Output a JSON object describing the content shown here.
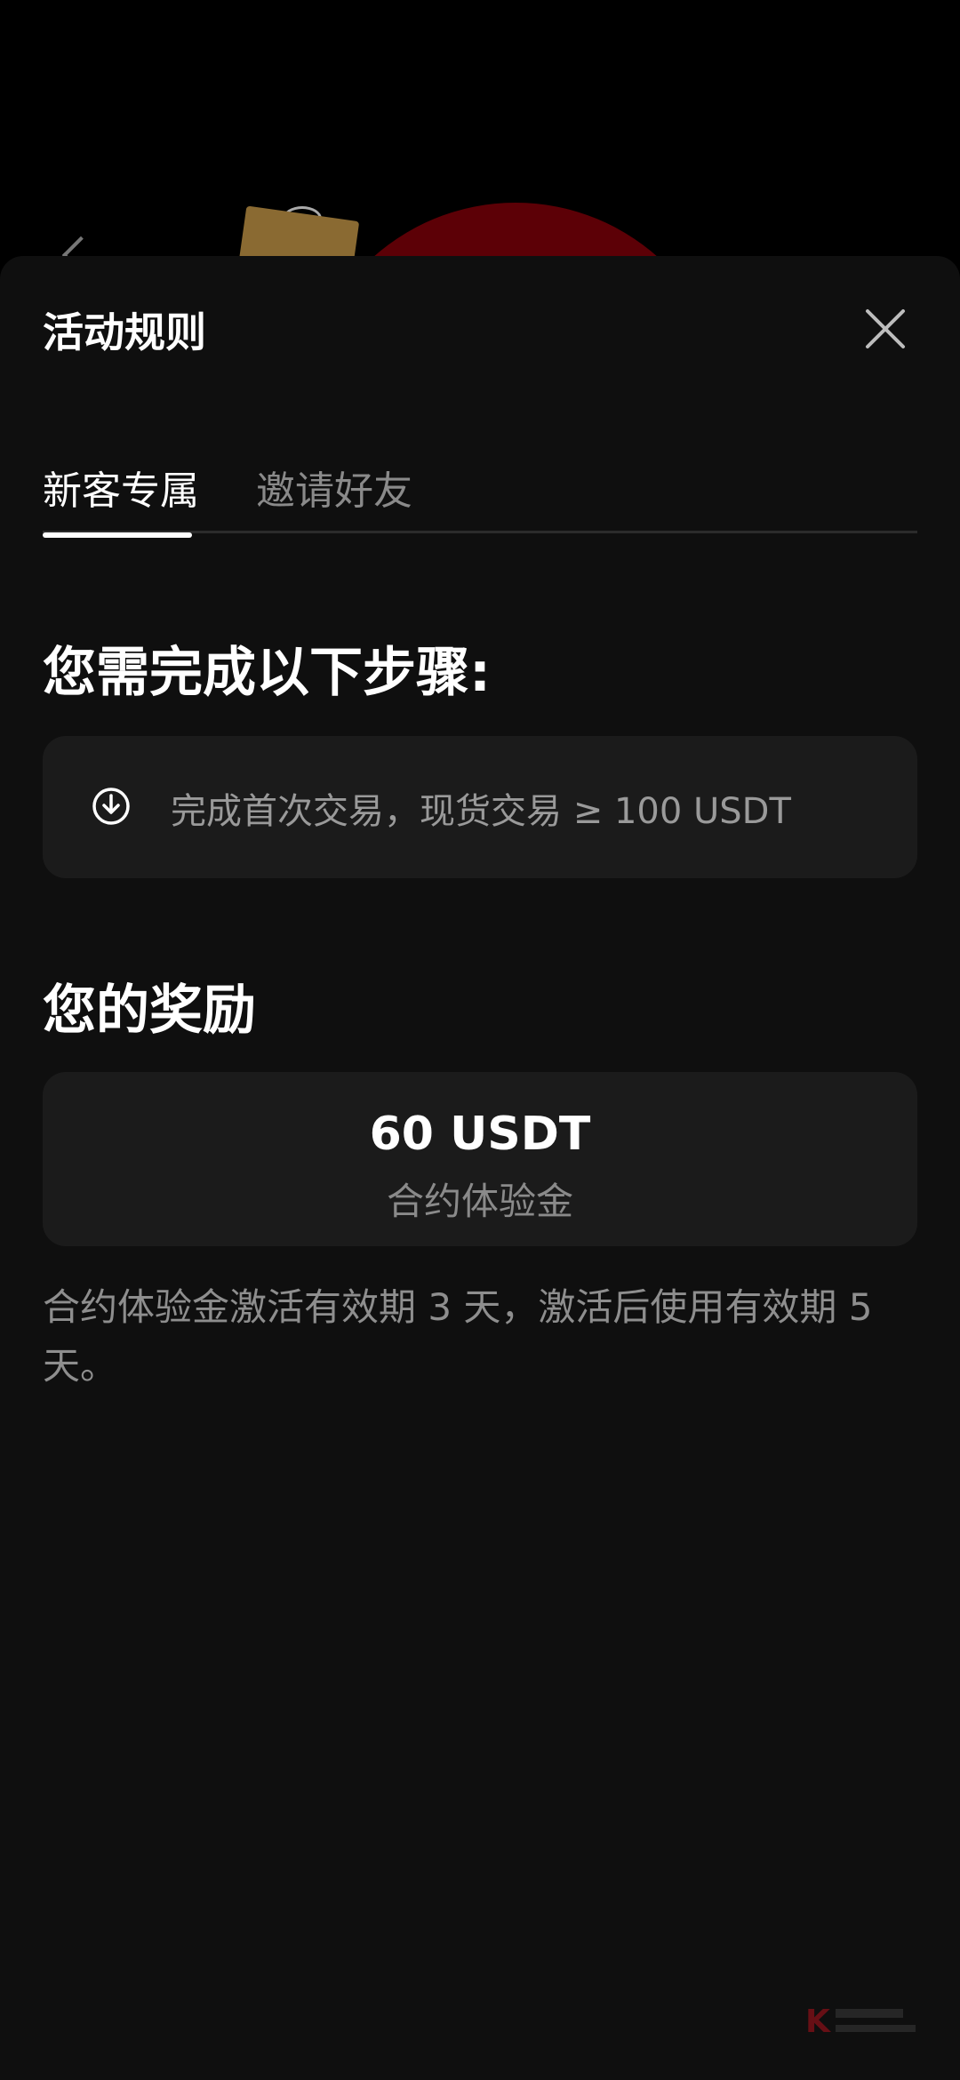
{
  "sheet": {
    "title": "活动规则",
    "close_icon": "close-icon"
  },
  "tabs": [
    {
      "label": "新客专属",
      "active": true
    },
    {
      "label": "邀请好友",
      "active": false
    }
  ],
  "steps": {
    "title": "您需完成以下步骤:",
    "items": [
      {
        "icon": "download-icon",
        "text": "完成首次交易，现货交易 ≥ 100 USDT"
      }
    ]
  },
  "reward": {
    "title": "您的奖励",
    "amount": "60 USDT",
    "label": "合约体验金"
  },
  "note": "合约体验金激活有效期 3 天，激活后使用有效期 5 天。",
  "colors": {
    "background": "#0f0f0f",
    "card": "#1b1b1b",
    "text_primary": "#ffffff",
    "text_secondary": "#8a8a8a",
    "accent_red": "#5c0006"
  }
}
